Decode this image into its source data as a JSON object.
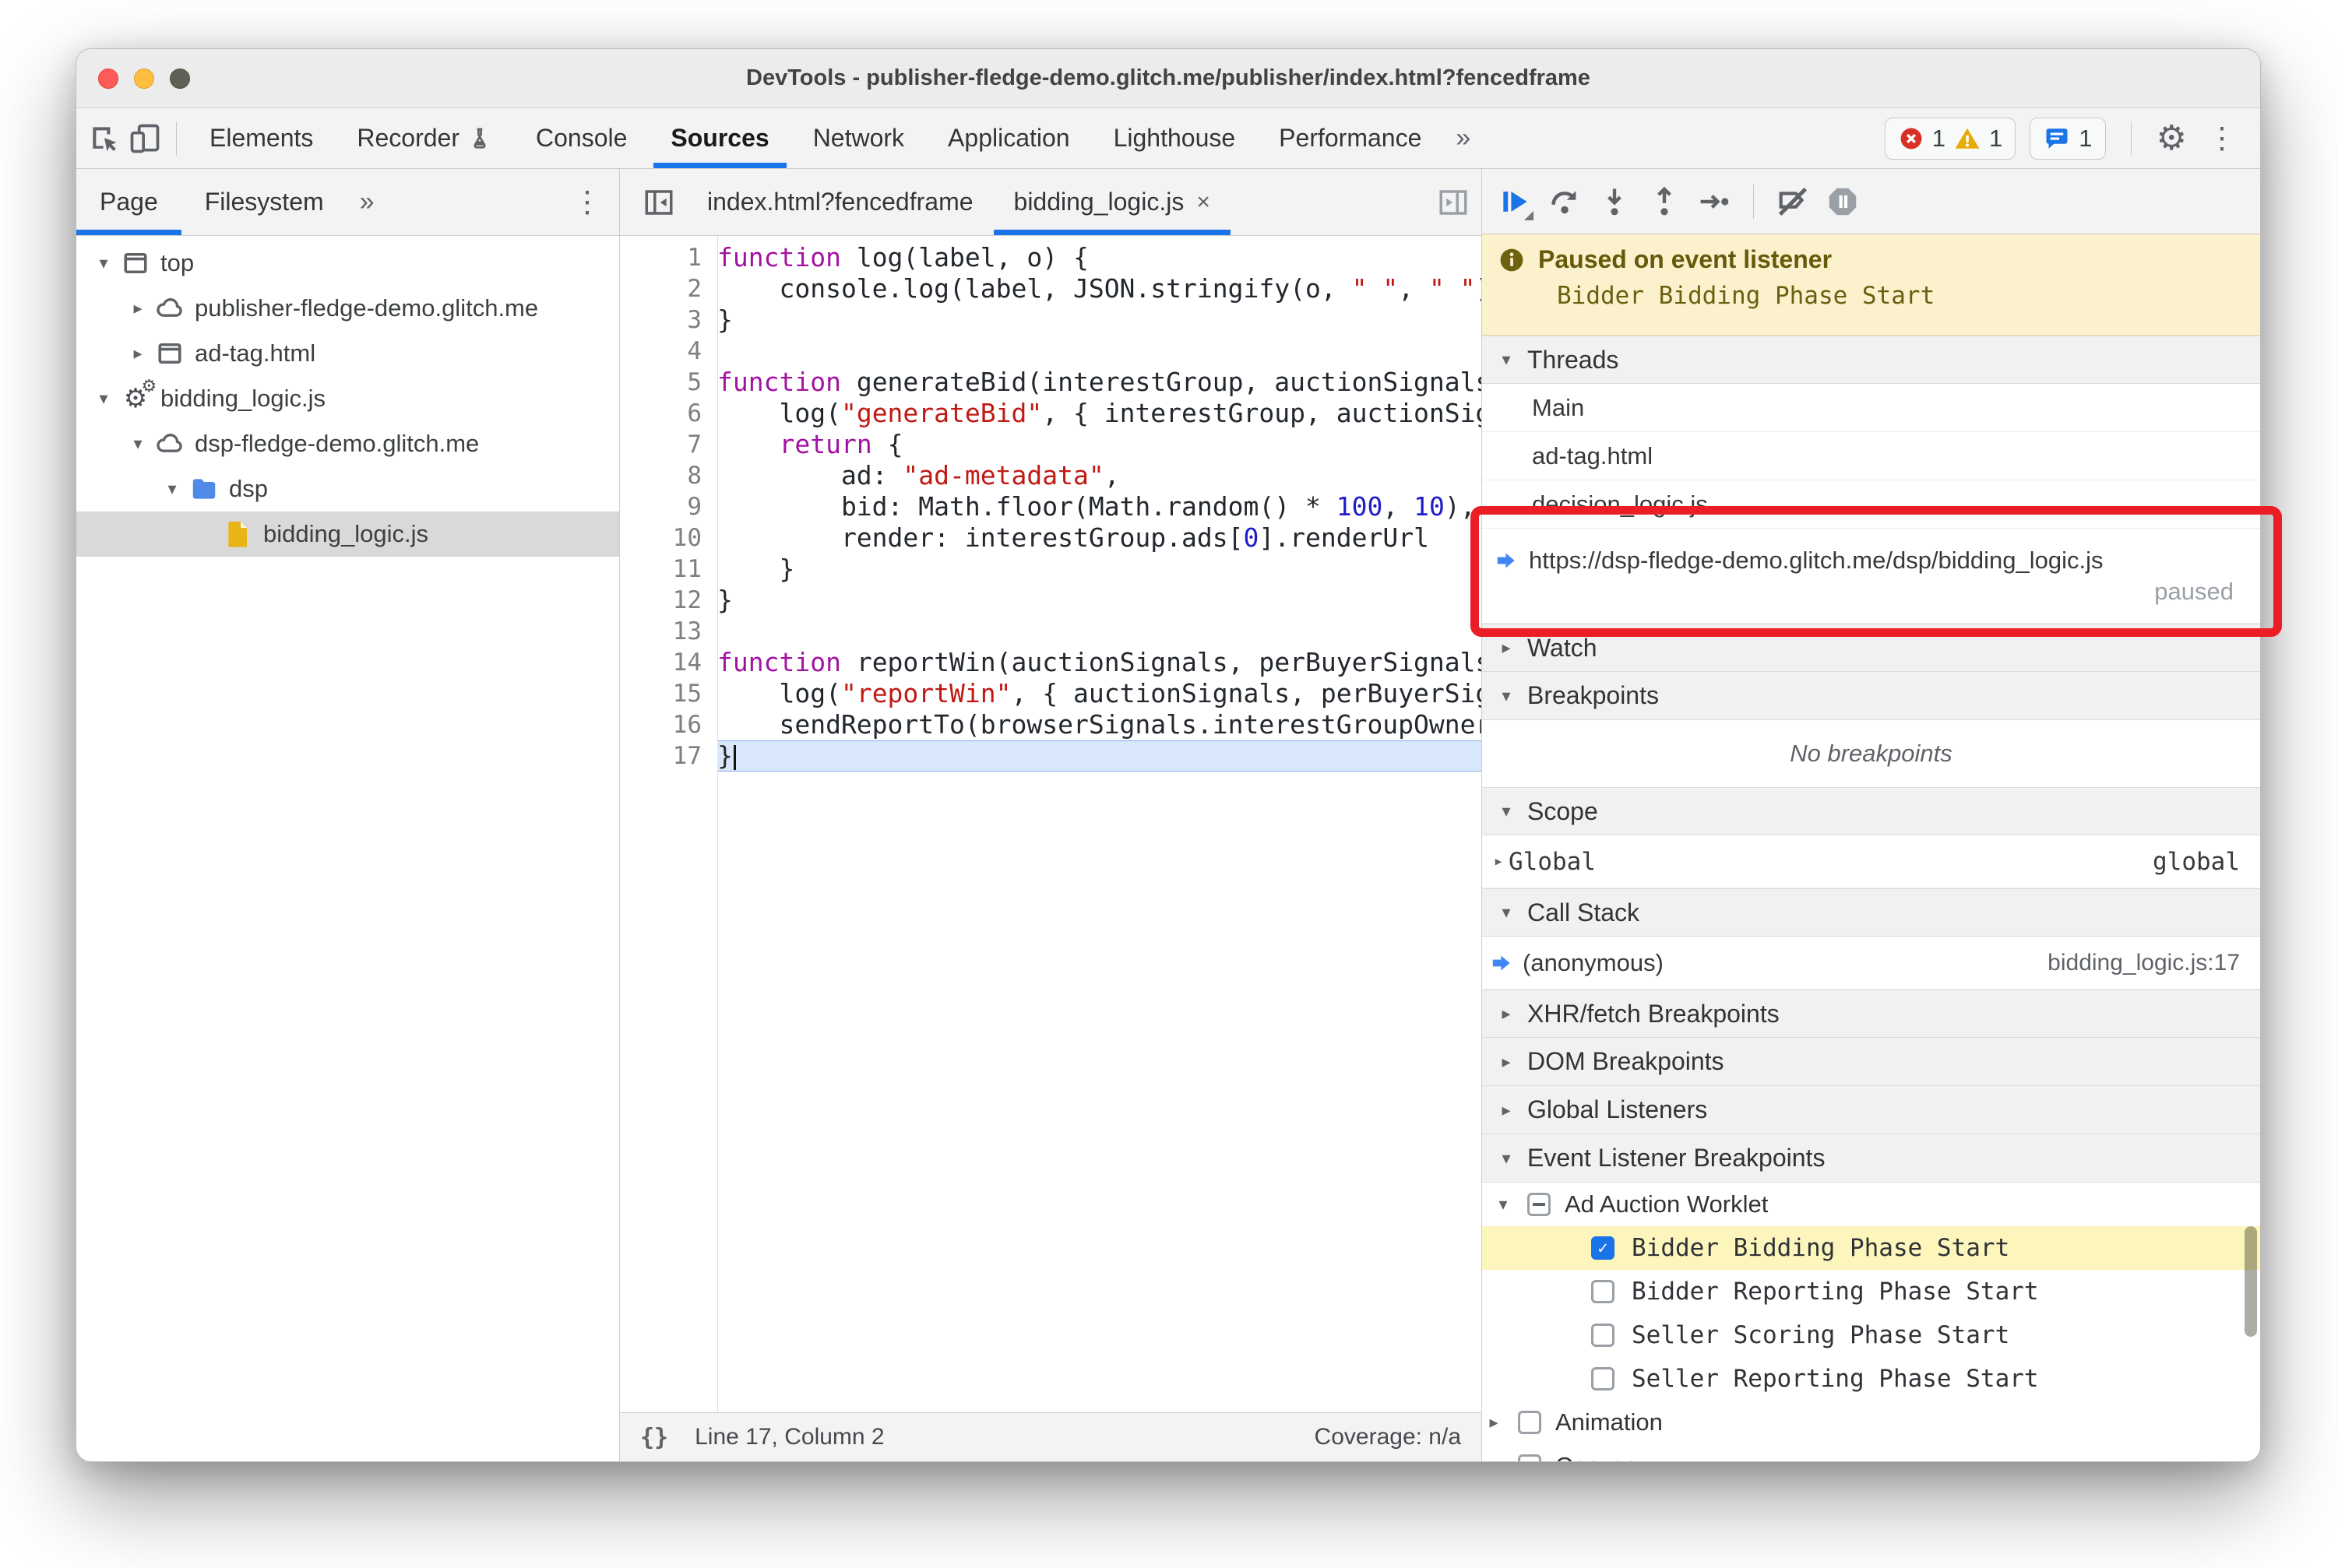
{
  "window": {
    "title": "DevTools - publisher-fledge-demo.glitch.me/publisher/index.html?fencedframe"
  },
  "toolbar": {
    "icons": [
      "inspect-icon",
      "device-toolbar-icon"
    ],
    "tabs": [
      {
        "label": "Elements",
        "selected": false
      },
      {
        "label": "Recorder",
        "selected": false,
        "trailing_icon": "flask-icon"
      },
      {
        "label": "Console",
        "selected": false
      },
      {
        "label": "Sources",
        "selected": true
      },
      {
        "label": "Network",
        "selected": false
      },
      {
        "label": "Application",
        "selected": false
      },
      {
        "label": "Lighthouse",
        "selected": false
      },
      {
        "label": "Performance",
        "selected": false
      }
    ],
    "more_tabs": "»",
    "badges": {
      "errors": "1",
      "warnings": "1",
      "issues": "1"
    },
    "kebab": "⋮"
  },
  "sidebar": {
    "tabs": [
      {
        "label": "Page",
        "selected": true
      },
      {
        "label": "Filesystem",
        "selected": false
      }
    ],
    "more_tabs": "»",
    "kebab": "⋮",
    "tree": [
      {
        "label": "top",
        "icon": "frame-icon",
        "expand": "open",
        "indent": 0,
        "selected": false
      },
      {
        "label": "publisher-fledge-demo.glitch.me",
        "icon": "cloud-icon",
        "expand": "closed",
        "indent": 1,
        "selected": false
      },
      {
        "label": "ad-tag.html",
        "icon": "frame-icon",
        "expand": "closed",
        "indent": 1,
        "selected": false
      },
      {
        "label": "bidding_logic.js",
        "icon": "worklet-gears-icon",
        "expand": "open",
        "indent": 0,
        "selected": false
      },
      {
        "label": "dsp-fledge-demo.glitch.me",
        "icon": "cloud-icon",
        "expand": "open",
        "indent": 1,
        "selected": false
      },
      {
        "label": "dsp",
        "icon": "folder-icon",
        "expand": "open",
        "indent": 2,
        "selected": false
      },
      {
        "label": "bidding_logic.js",
        "icon": "file-icon",
        "expand": "none",
        "indent": 3,
        "selected": true
      }
    ]
  },
  "editor": {
    "collapse_icon": "collapse-sidebar-icon",
    "expand_icon": "expand-pane-icon",
    "tabs": [
      {
        "label": "index.html?fencedframe",
        "selected": false,
        "closable": false
      },
      {
        "label": "bidding_logic.js",
        "selected": true,
        "closable": true,
        "close_glyph": "×"
      }
    ],
    "lines": [
      {
        "n": "1",
        "tokens": [
          [
            "k",
            "function"
          ],
          [
            "p",
            " log(label, o) {"
          ]
        ]
      },
      {
        "n": "2",
        "tokens": [
          [
            "p",
            "    console.log(label, JSON.stringify(o, "
          ],
          [
            "s",
            "\" \""
          ],
          [
            "p",
            ", "
          ],
          [
            "s",
            "\" \""
          ],
          [
            "p",
            "));"
          ]
        ]
      },
      {
        "n": "3",
        "tokens": [
          [
            "p",
            "}"
          ]
        ]
      },
      {
        "n": "4",
        "tokens": []
      },
      {
        "n": "5",
        "tokens": [
          [
            "k",
            "function"
          ],
          [
            "p",
            " generateBid(interestGroup, auctionSignals, perBuyerSignals, trustedBiddingSignals, browserSignals) {"
          ]
        ]
      },
      {
        "n": "6",
        "tokens": [
          [
            "p",
            "    log("
          ],
          [
            "s",
            "\"generateBid\""
          ],
          [
            "p",
            ", { interestGroup, auctionSignals });"
          ]
        ]
      },
      {
        "n": "7",
        "tokens": [
          [
            "p",
            "    "
          ],
          [
            "k",
            "return"
          ],
          [
            "p",
            " {"
          ]
        ]
      },
      {
        "n": "8",
        "tokens": [
          [
            "p",
            "        ad: "
          ],
          [
            "s",
            "\"ad-metadata\""
          ],
          [
            "p",
            ","
          ]
        ]
      },
      {
        "n": "9",
        "tokens": [
          [
            "p",
            "        bid: Math.floor(Math.random() * "
          ],
          [
            "n2",
            "100"
          ],
          [
            "p",
            ", "
          ],
          [
            "n2",
            "10"
          ],
          [
            "p",
            "),"
          ]
        ]
      },
      {
        "n": "10",
        "tokens": [
          [
            "p",
            "        render: interestGroup.ads["
          ],
          [
            "n2",
            "0"
          ],
          [
            "p",
            "].renderUrl"
          ]
        ]
      },
      {
        "n": "11",
        "tokens": [
          [
            "p",
            "    }"
          ]
        ]
      },
      {
        "n": "12",
        "tokens": [
          [
            "p",
            "}"
          ]
        ]
      },
      {
        "n": "13",
        "tokens": []
      },
      {
        "n": "14",
        "tokens": [
          [
            "k",
            "function"
          ],
          [
            "p",
            " reportWin(auctionSignals, perBuyerSignals, sellerSignals, browserSignals) {"
          ]
        ]
      },
      {
        "n": "15",
        "tokens": [
          [
            "p",
            "    log("
          ],
          [
            "s",
            "\"reportWin\""
          ],
          [
            "p",
            ", { auctionSignals, perBuyerSignals });"
          ]
        ]
      },
      {
        "n": "16",
        "tokens": [
          [
            "p",
            "    sendReportTo(browserSignals.interestGroupOwner);"
          ]
        ]
      },
      {
        "n": "17",
        "tokens": [
          [
            "p",
            "}"
          ]
        ],
        "current": true
      }
    ],
    "status": {
      "line_col": "Line 17, Column 2",
      "coverage": "Coverage: n/a",
      "format_glyph": "{}"
    }
  },
  "debugger": {
    "toolbar_icons": [
      "resume-icon",
      "step-over-icon",
      "step-into-icon",
      "step-out-icon",
      "step-icon",
      "divider",
      "deactivate-breakpoints-icon",
      "pause-on-exceptions-icon"
    ],
    "paused": {
      "title": "Paused on event listener",
      "detail": "Bidder Bidding Phase Start"
    },
    "sections": [
      {
        "type": "header",
        "label": "Threads",
        "arrow": "open",
        "h": 62
      },
      {
        "type": "thread",
        "label": "Main",
        "h": 62
      },
      {
        "type": "thread",
        "label": "ad-tag.html",
        "h": 62
      },
      {
        "type": "thread",
        "label": "decision_logic.js",
        "h": 62
      },
      {
        "type": "thread_paused",
        "label": "https://dsp-fledge-demo.glitch.me/dsp/bidding_logic.js",
        "status": "paused",
        "h": 122
      },
      {
        "type": "header",
        "label": "Watch",
        "arrow": "closed",
        "h": 62
      },
      {
        "type": "header",
        "label": "Breakpoints",
        "arrow": "open",
        "h": 62
      },
      {
        "type": "empty",
        "label": "No breakpoints",
        "h": 86
      },
      {
        "type": "header",
        "label": "Scope",
        "arrow": "open",
        "h": 62
      },
      {
        "type": "scope",
        "label": "Global",
        "value": "global",
        "arrow": "closed",
        "h": 68
      },
      {
        "type": "header",
        "label": "Call Stack",
        "arrow": "open",
        "h": 62
      },
      {
        "type": "frame",
        "label": "(anonymous)",
        "location": "bidding_logic.js:17",
        "h": 68
      },
      {
        "type": "header",
        "label": "XHR/fetch Breakpoints",
        "arrow": "closed",
        "h": 62
      },
      {
        "type": "header",
        "label": "DOM Breakpoints",
        "arrow": "closed",
        "h": 62
      },
      {
        "type": "header",
        "label": "Global Listeners",
        "arrow": "closed",
        "h": 62
      },
      {
        "type": "header",
        "label": "Event Listener Breakpoints",
        "arrow": "open",
        "h": 62
      },
      {
        "type": "category",
        "label": "Ad Auction Worklet",
        "arrow": "open",
        "checkbox": "indeterminate",
        "h": 56
      },
      {
        "type": "listener",
        "label": "Bidder Bidding Phase Start",
        "checkbox": "checked",
        "highlighted": true,
        "h": 56
      },
      {
        "type": "listener",
        "label": "Bidder Reporting Phase Start",
        "checkbox": "unchecked",
        "h": 56
      },
      {
        "type": "listener",
        "label": "Seller Scoring Phase Start",
        "checkbox": "unchecked",
        "h": 56
      },
      {
        "type": "listener",
        "label": "Seller Reporting Phase Start",
        "checkbox": "unchecked",
        "h": 56
      },
      {
        "type": "category2",
        "label": "Animation",
        "arrow": "closed",
        "checkbox": "unchecked",
        "h": 56
      },
      {
        "type": "category2",
        "label": "Canvas",
        "arrow": "closed",
        "checkbox": "unchecked",
        "h": 56
      }
    ]
  },
  "colors": {
    "accent": "#1a73e8",
    "error": "#d93025",
    "warning": "#f0a800",
    "paused_bg": "#fbf1cd",
    "annotation": "#eb1d25"
  }
}
